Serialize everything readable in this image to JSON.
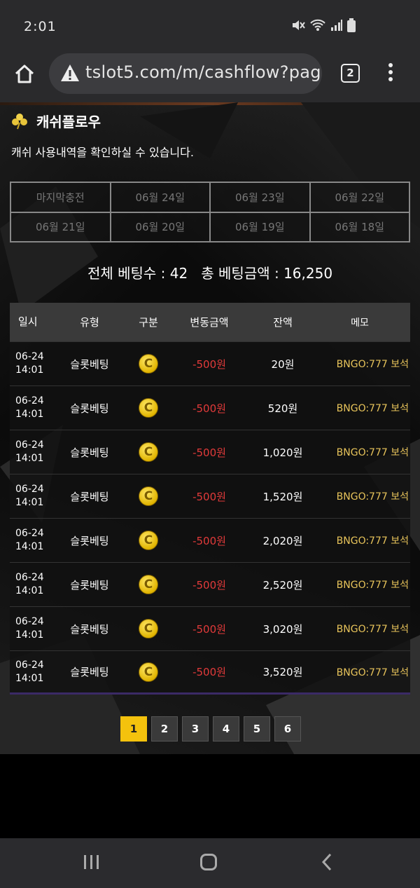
{
  "status_bar": {
    "time": "2:01"
  },
  "browser": {
    "url": "tslot5.com/m/cashflow?page",
    "tab_count": "2"
  },
  "page": {
    "title": "캐쉬플로우",
    "description": "캐쉬 사용내역을 확인하실 수 있습니다.",
    "date_filters": [
      "마지막충전",
      "06월 24일",
      "06월 23일",
      "06월 22일",
      "06월 21일",
      "06월 20일",
      "06월 19일",
      "06월 18일"
    ],
    "summary": "전체 베팅수 : 42   총 베팅금액 : 16,250",
    "table": {
      "headers": [
        "일시",
        "유형",
        "구분",
        "변동금액",
        "잔액",
        "메모"
      ],
      "rows": [
        {
          "date": "06-24",
          "time": "14:01",
          "type": "슬롯베팅",
          "icon": "C",
          "change": "-500원",
          "balance": "20원",
          "memo": "BNGO:777 보석"
        },
        {
          "date": "06-24",
          "time": "14:01",
          "type": "슬롯베팅",
          "icon": "C",
          "change": "-500원",
          "balance": "520원",
          "memo": "BNGO:777 보석"
        },
        {
          "date": "06-24",
          "time": "14:01",
          "type": "슬롯베팅",
          "icon": "C",
          "change": "-500원",
          "balance": "1,020원",
          "memo": "BNGO:777 보석"
        },
        {
          "date": "06-24",
          "time": "14:01",
          "type": "슬롯베팅",
          "icon": "C",
          "change": "-500원",
          "balance": "1,520원",
          "memo": "BNGO:777 보석"
        },
        {
          "date": "06-24",
          "time": "14:01",
          "type": "슬롯베팅",
          "icon": "C",
          "change": "-500원",
          "balance": "2,020원",
          "memo": "BNGO:777 보석"
        },
        {
          "date": "06-24",
          "time": "14:01",
          "type": "슬롯베팅",
          "icon": "C",
          "change": "-500원",
          "balance": "2,520원",
          "memo": "BNGO:777 보석"
        },
        {
          "date": "06-24",
          "time": "14:01",
          "type": "슬롯베팅",
          "icon": "C",
          "change": "-500원",
          "balance": "3,020원",
          "memo": "BNGO:777 보석"
        },
        {
          "date": "06-24",
          "time": "14:01",
          "type": "슬롯베팅",
          "icon": "C",
          "change": "-500원",
          "balance": "3,520원",
          "memo": "BNGO:777 보석"
        }
      ]
    },
    "pagination": [
      "1",
      "2",
      "3",
      "4",
      "5",
      "6"
    ],
    "active_page": "1"
  },
  "colors": {
    "accent": "#f4c20d",
    "negative": "#e23a3a",
    "memo": "#e7c35a"
  }
}
